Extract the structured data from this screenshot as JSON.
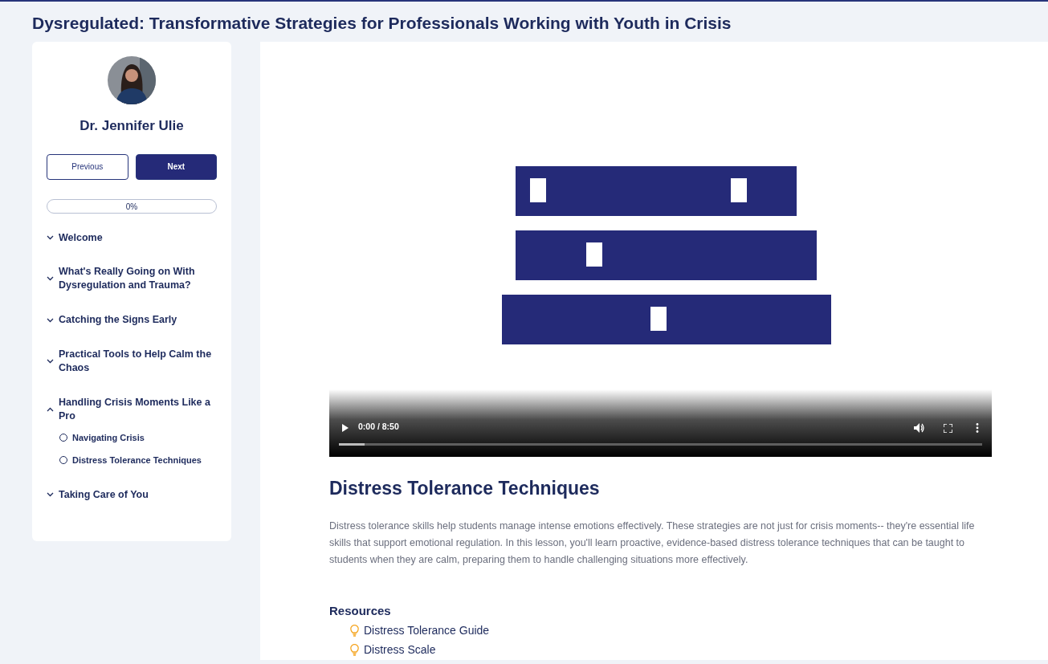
{
  "course_title": "Dysregulated: Transformative Strategies for Professionals Working with Youth in Crisis",
  "instructor": {
    "name": "Dr. Jennifer Ulie"
  },
  "nav_buttons": [
    {
      "label": "Previous",
      "kind": "outline"
    },
    {
      "label": "Next",
      "kind": "solid"
    }
  ],
  "progress": {
    "level": 0,
    "reading": "0%"
  },
  "modules": [
    {
      "title": "Welcome",
      "expanded": false
    },
    {
      "title": "What's Really Going on With Dysregulation and Trauma?",
      "expanded": false
    },
    {
      "title": "Catching the Signs Early",
      "expanded": false
    },
    {
      "title": "Practical Tools to Help Calm the Chaos",
      "expanded": false
    },
    {
      "title": "Handling Crisis Moments Like a Pro",
      "expanded": true,
      "lessons": [
        {
          "title": "Navigating Crisis",
          "completed": false
        },
        {
          "title": "Distress Tolerance Techniques",
          "completed": false
        }
      ]
    },
    {
      "title": "Taking Care of You",
      "expanded": false
    }
  ],
  "video": {
    "time": "0:00 / 8:50",
    "level": 0.04
  },
  "lesson": {
    "title": "Distress Tolerance Techniques",
    "body": "Distress tolerance skills help students manage intense emotions effectively. These strategies are not just for crisis moments-- they're essential life skills that support emotional regulation. In this lesson, you'll learn proactive, evidence-based distress tolerance techniques that can be taught to students when they are calm, preparing them to handle challenging situations more effectively."
  },
  "resources": {
    "heading": "Resources",
    "items": [
      "Distress Tolerance Guide",
      "Distress Scale"
    ]
  }
}
